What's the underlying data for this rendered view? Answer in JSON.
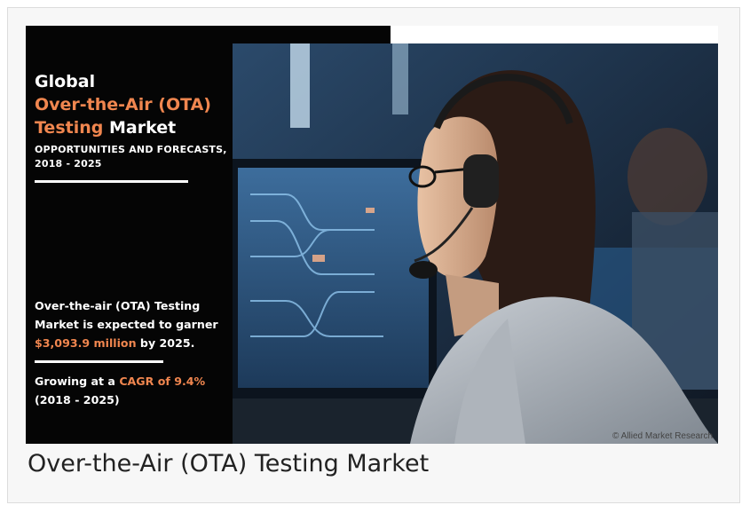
{
  "infographic": {
    "title_line1": "Global",
    "title_line2": "Over-the-Air (OTA)",
    "title_line3_accent": "Testing",
    "title_line3_rest": " Market",
    "subtitle": "OPPORTUNITIES AND FORECASTS, 2018 - 2025",
    "stat1_text": "Over-the-air (OTA) Testing Market is expected to garner ",
    "stat1_highlight": "$3,093.9 million",
    "stat1_tail": " by 2025.",
    "stat2_text": "Growing at a ",
    "stat2_highlight": "CAGR of 9.4%",
    "stat2_tail": " (2018 - 2025)",
    "copyright": "© Allied Market Research",
    "accent_color": "#f0864f"
  },
  "caption": "Over-the-Air (OTA) Testing Market"
}
